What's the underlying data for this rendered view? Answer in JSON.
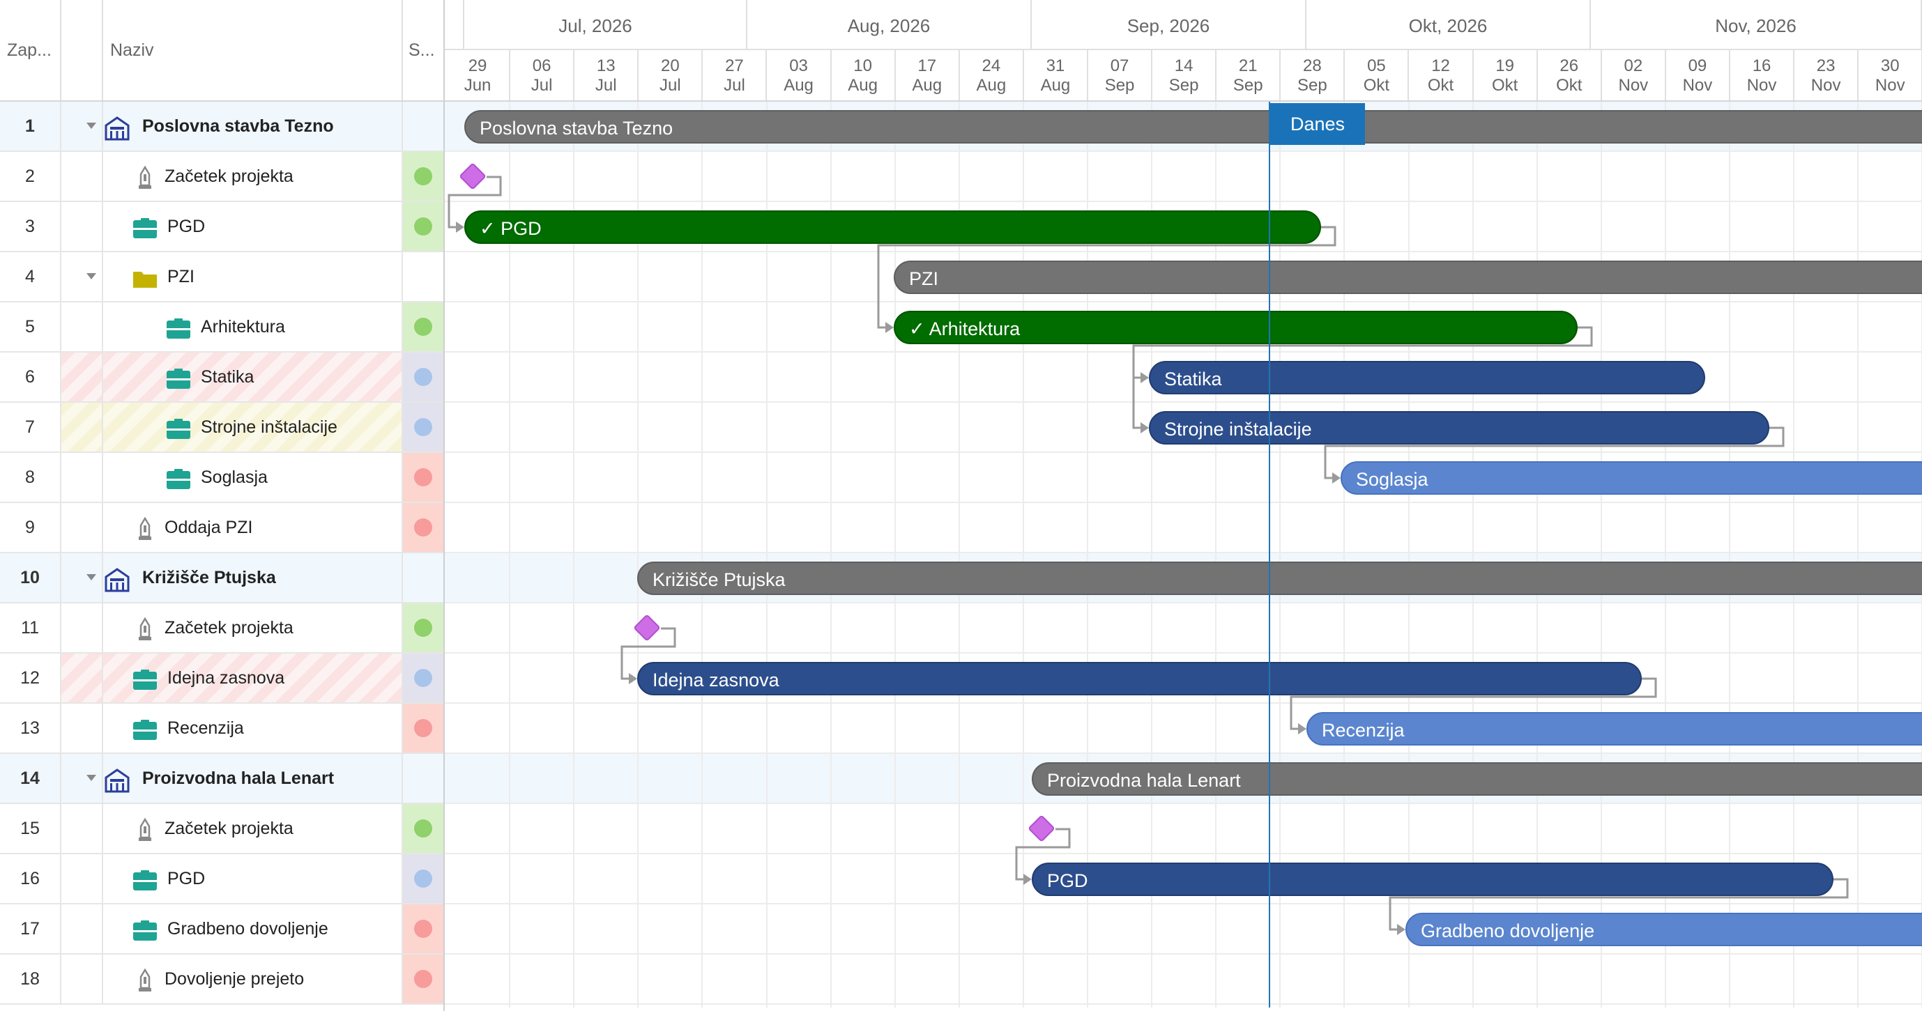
{
  "grid": {
    "columns": {
      "num": "Zap...",
      "name": "Naziv",
      "status": "S..."
    },
    "rows": [
      {
        "num": "1",
        "name": "Poslovna stavba Tezno",
        "type": "project",
        "status": null
      },
      {
        "num": "2",
        "name": "Začetek projekta",
        "type": "milestone",
        "status": "green"
      },
      {
        "num": "3",
        "name": "PGD",
        "type": "task",
        "status": "green"
      },
      {
        "num": "4",
        "name": "PZI",
        "type": "folder",
        "status": null
      },
      {
        "num": "5",
        "name": "Arhitektura",
        "type": "task",
        "status": "green"
      },
      {
        "num": "6",
        "name": "Statika",
        "type": "task",
        "status": "blue",
        "stripe": "red"
      },
      {
        "num": "7",
        "name": "Strojne inštalacije",
        "type": "task",
        "status": "blue",
        "stripe": "yellow"
      },
      {
        "num": "8",
        "name": "Soglasja",
        "type": "task",
        "status": "red"
      },
      {
        "num": "9",
        "name": "Oddaja PZI",
        "type": "milestone",
        "status": "red"
      },
      {
        "num": "10",
        "name": "Križišče Ptujska",
        "type": "project",
        "status": null
      },
      {
        "num": "11",
        "name": "Začetek projekta",
        "type": "milestone",
        "status": "green"
      },
      {
        "num": "12",
        "name": "Idejna zasnova",
        "type": "task",
        "status": "blue",
        "stripe": "red"
      },
      {
        "num": "13",
        "name": "Recenzija",
        "type": "task",
        "status": "red"
      },
      {
        "num": "14",
        "name": "Proizvodna hala Lenart",
        "type": "project",
        "status": null
      },
      {
        "num": "15",
        "name": "Začetek projekta",
        "type": "milestone",
        "status": "green"
      },
      {
        "num": "16",
        "name": "PGD",
        "type": "task",
        "status": "blue"
      },
      {
        "num": "17",
        "name": "Gradbeno dovoljenje",
        "type": "task",
        "status": "red"
      },
      {
        "num": "18",
        "name": "Dovoljenje prejeto",
        "type": "milestone",
        "status": "red"
      }
    ]
  },
  "timeline": {
    "months": [
      "Jul, 2026",
      "Aug, 2026",
      "Sep, 2026",
      "Okt, 2026",
      "Nov, 2026"
    ],
    "weeks": [
      {
        "day": "29",
        "month": "Jun"
      },
      {
        "day": "06",
        "month": "Jul"
      },
      {
        "day": "13",
        "month": "Jul"
      },
      {
        "day": "20",
        "month": "Jul"
      },
      {
        "day": "27",
        "month": "Jul"
      },
      {
        "day": "03",
        "month": "Aug"
      },
      {
        "day": "10",
        "month": "Aug"
      },
      {
        "day": "17",
        "month": "Aug"
      },
      {
        "day": "24",
        "month": "Aug"
      },
      {
        "day": "31",
        "month": "Aug"
      },
      {
        "day": "07",
        "month": "Sep"
      },
      {
        "day": "14",
        "month": "Sep"
      },
      {
        "day": "21",
        "month": "Sep"
      },
      {
        "day": "28",
        "month": "Sep"
      },
      {
        "day": "05",
        "month": "Okt"
      },
      {
        "day": "12",
        "month": "Okt"
      },
      {
        "day": "19",
        "month": "Okt"
      },
      {
        "day": "26",
        "month": "Okt"
      },
      {
        "day": "02",
        "month": "Nov"
      },
      {
        "day": "09",
        "month": "Nov"
      },
      {
        "day": "16",
        "month": "Nov"
      },
      {
        "day": "23",
        "month": "Nov"
      },
      {
        "day": "30",
        "month": "Nov"
      }
    ],
    "today_label": "Danes",
    "bars": [
      {
        "row": 0,
        "kind": "gray",
        "label": "Poslovna stavba Tezno"
      },
      {
        "row": 1,
        "kind": "milestone"
      },
      {
        "row": 2,
        "kind": "green",
        "label": "✓ PGD"
      },
      {
        "row": 3,
        "kind": "gray",
        "label": "PZI"
      },
      {
        "row": 4,
        "kind": "green",
        "label": "✓ Arhitektura"
      },
      {
        "row": 5,
        "kind": "navy",
        "label": "Statika"
      },
      {
        "row": 6,
        "kind": "navy",
        "label": "Strojne inštalacije"
      },
      {
        "row": 7,
        "kind": "light",
        "label": "Soglasja"
      },
      {
        "row": 8,
        "kind": "milestone"
      },
      {
        "row": 9,
        "kind": "gray",
        "label": "Križišče Ptujska"
      },
      {
        "row": 10,
        "kind": "milestone"
      },
      {
        "row": 11,
        "kind": "navy",
        "label": "Idejna zasnova"
      },
      {
        "row": 12,
        "kind": "light",
        "label": "Recenzija"
      },
      {
        "row": 13,
        "kind": "gray",
        "label": "Proizvodna hala Lenart"
      },
      {
        "row": 14,
        "kind": "milestone"
      },
      {
        "row": 15,
        "kind": "navy",
        "label": "PGD"
      },
      {
        "row": 16,
        "kind": "light",
        "label": "Gradbeno dovoljenje"
      },
      {
        "row": 17,
        "kind": "milestone"
      }
    ]
  },
  "colors": {
    "status_green": "#8fd16a",
    "status_blue": "#a9c4ea",
    "status_red": "#f79b9b",
    "status_green_bg": "#d8f0c8",
    "status_blue_bg": "#e2e2ee",
    "status_red_bg": "#fcd5cf",
    "project_icon": "#2c3e9a",
    "task_icon": "#1fa393",
    "folder_icon": "#c3b300",
    "today": "#1a73b8"
  }
}
